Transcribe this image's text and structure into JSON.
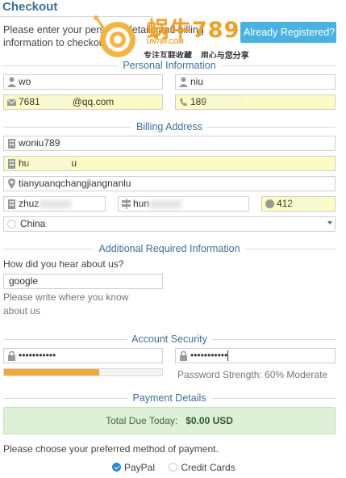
{
  "page": {
    "title": "Checkout",
    "intro": "Please enter your personal details and billing information to checkout.",
    "registered_button": "Already Registered?"
  },
  "watermark": {
    "main": "蜗牛789",
    "site": "UN789.COM",
    "slogan_left": "专注互联收藏",
    "slogan_right": "用心与您分享"
  },
  "sections": {
    "personal": "Personal Information",
    "billing": "Billing Address",
    "additional": "Additional Required Information",
    "security": "Account Security",
    "payment": "Payment Details"
  },
  "personal": {
    "first_name": "wo",
    "last_name": "niu",
    "email_prefix": "7681",
    "email_suffix": "@qq.com",
    "phone_prefix": "189"
  },
  "billing": {
    "company": "woniu789",
    "address1_prefix": "hu",
    "address1_suffix": "u",
    "address2": "tianyuanqchangjiangnanlu",
    "city": "zhuz",
    "state": "hun",
    "postcode": "412",
    "country": "China"
  },
  "additional": {
    "question": "How did you hear about us?",
    "answer": "google",
    "hint": "Please write where you know about us"
  },
  "security": {
    "password": "•••••••••••",
    "confirm_password": "•••••••••••",
    "strength_label": "Password Strength: 60% Moderate",
    "strength_value": 0.6
  },
  "payment": {
    "total_label": "Total Due Today:",
    "total_value": "$0.00 USD",
    "choose_method": "Please choose your preferred method of payment.",
    "methods": [
      "PayPal",
      "Credit Cards"
    ],
    "selected": "PayPal"
  },
  "colors": {
    "accent": "#4ab2e3",
    "heading": "#3b6f9a",
    "autofill": "#fbfbc4",
    "strength": "#f0a73d",
    "success_bg": "#dff0d8"
  }
}
